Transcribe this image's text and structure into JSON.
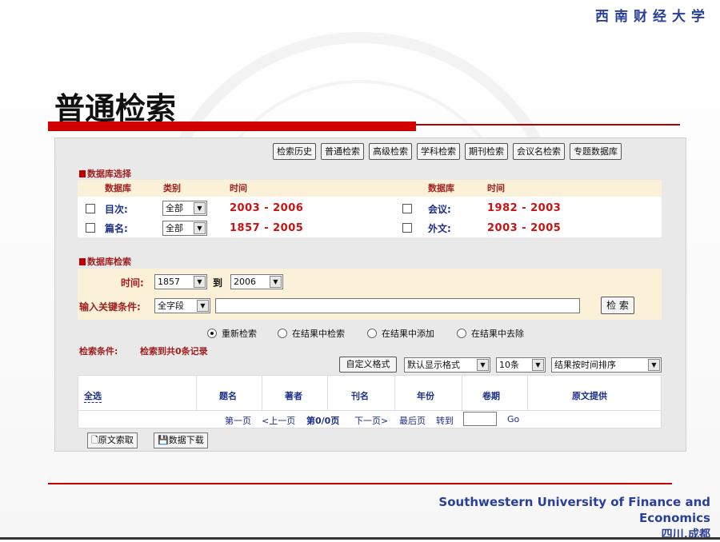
{
  "header": {
    "university_cn": "西南财经大学",
    "slide_title": "普通检索"
  },
  "footer": {
    "university_en": "Southwestern University of Finance and Economics",
    "city": "四川.成都"
  },
  "toolbar": {
    "buttons": [
      "检索历史",
      "普通检索",
      "高级检索",
      "学科检索",
      "期刊检索",
      "会议名检索",
      "专题数据库"
    ]
  },
  "db_select": {
    "section_label": "数据库选择",
    "col_db": "数据库",
    "col_type": "类别",
    "col_time": "时间",
    "col_db2": "数据库",
    "col_time2": "时间",
    "rows": [
      {
        "name": "目次:",
        "type": "全部",
        "years": "2003 - 2006",
        "name2": "会议:",
        "years2": "1982 - 2003"
      },
      {
        "name": "篇名:",
        "type": "全部",
        "years": "1857 - 2005",
        "name2": "外文:",
        "years2": "2003 - 2005"
      }
    ]
  },
  "db_search": {
    "section_label": "数据库检索",
    "time_label": "时间:",
    "from_year": "1857",
    "to_label": "到",
    "to_year": "2006",
    "keyword_label": "输入关键条件:",
    "field": "全字段",
    "keyword_value": "",
    "search_button": "检 索"
  },
  "radios": {
    "options": [
      "重新检索",
      "在结果中检索",
      "在结果中添加",
      "在结果中去除"
    ],
    "selected": 0
  },
  "results": {
    "cond_label": "检索条件:",
    "cond_value": "检索到共0条记录",
    "custom_format": "自定义格式",
    "display_format": "默认显示格式",
    "page_size": "10条",
    "sort": "结果按时间排序",
    "select_all": "全选",
    "columns": [
      "题名",
      "著者",
      "刊名",
      "年份",
      "卷期",
      "原文提供"
    ],
    "pager": {
      "first": "第一页",
      "prev": "<上一页",
      "status": "第0/0页",
      "next": "下一页>",
      "last": "最后页",
      "goto": "转到",
      "go": "Go"
    }
  },
  "bottom_buttons": {
    "request": "原文索取",
    "download": "数据下载"
  },
  "colors": {
    "accent_red": "#d10000",
    "brand_blue": "#2a3f9b",
    "year_red": "#cc1111"
  }
}
